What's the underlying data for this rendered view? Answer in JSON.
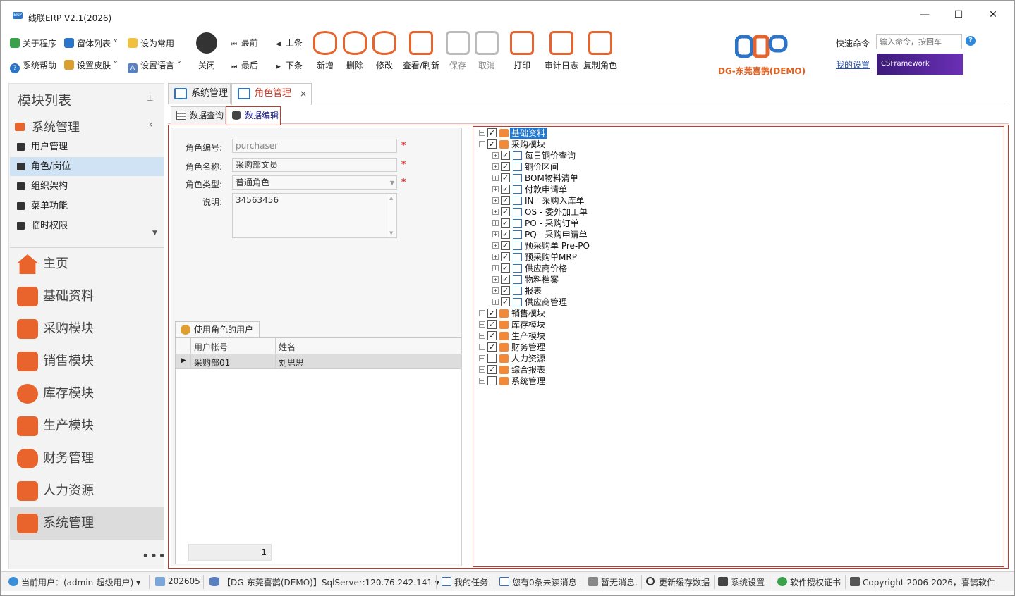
{
  "app": {
    "title": "线联ERP V2.1(2026)",
    "logo_text": "ERP"
  },
  "window_controls": {
    "minimize": "—",
    "maximize": "☐",
    "close": "✕"
  },
  "quick_menu": {
    "about": "关于程序",
    "windows": "窗体列表",
    "set_common": "设为常用",
    "help": "系统帮助",
    "skin": "设置皮肤",
    "language": "设置语言"
  },
  "toolbar": {
    "close": "关闭",
    "first": "最前",
    "prev": "上条",
    "last": "最后",
    "next": "下条",
    "add": "新增",
    "delete": "删除",
    "edit": "修改",
    "view_refresh": "查看/刷新",
    "save": "保存",
    "cancel": "取消",
    "print": "打印",
    "audit_log": "审计日志",
    "copy_role": "复制角色"
  },
  "brand": {
    "company": "DG-东莞喜鹊(DEMO)",
    "banner": "CSFramework"
  },
  "command": {
    "label": "快速命令",
    "placeholder": "输入命令，按回车",
    "my_settings": "我的设置"
  },
  "sidebar": {
    "header": "模块列表",
    "pin": "📌",
    "section": "系统管理",
    "items": [
      {
        "label": "用户管理"
      },
      {
        "label": "角色/岗位"
      },
      {
        "label": "组织架构"
      },
      {
        "label": "菜单功能"
      },
      {
        "label": "临时权限"
      }
    ],
    "modules": [
      {
        "label": "主页"
      },
      {
        "label": "基础资料"
      },
      {
        "label": "采购模块"
      },
      {
        "label": "销售模块"
      },
      {
        "label": "库存模块"
      },
      {
        "label": "生产模块"
      },
      {
        "label": "财务管理"
      },
      {
        "label": "人力资源"
      },
      {
        "label": "系统管理"
      }
    ],
    "more": "•••"
  },
  "tabs": [
    {
      "label": "系统管理"
    },
    {
      "label": "角色管理"
    }
  ],
  "subtabs": [
    {
      "label": "数据查询"
    },
    {
      "label": "数据编辑"
    }
  ],
  "form": {
    "role_code_label": "角色编号:",
    "role_code": "purchaser",
    "role_name_label": "角色名称:",
    "role_name": "采购部文员",
    "role_type_label": "角色类型:",
    "role_type": "普通角色",
    "desc_label": "说明:",
    "desc": "34563456",
    "required_mark": "*"
  },
  "users_panel": {
    "tab": "使用角色的用户",
    "columns": [
      "用户帐号",
      "姓名"
    ],
    "rows": [
      {
        "account": "采购部01",
        "name": "刘思思"
      }
    ],
    "page": "1"
  },
  "tree": [
    {
      "label": "基础资料",
      "level": 0,
      "checked": true,
      "expanded": false,
      "selected": true
    },
    {
      "label": "采购模块",
      "level": 0,
      "checked": true,
      "expanded": true
    },
    {
      "label": "每日铜价查询",
      "level": 1,
      "checked": true
    },
    {
      "label": "铜价区间",
      "level": 1,
      "checked": true
    },
    {
      "label": "BOM物料清单",
      "level": 1,
      "checked": true
    },
    {
      "label": "付款申请单",
      "level": 1,
      "checked": true
    },
    {
      "label": "IN - 采购入库单",
      "level": 1,
      "checked": true
    },
    {
      "label": "OS - 委外加工单",
      "level": 1,
      "checked": true
    },
    {
      "label": "PO - 采购订单",
      "level": 1,
      "checked": true
    },
    {
      "label": "PQ - 采购申请单",
      "level": 1,
      "checked": true
    },
    {
      "label": "预采购单 Pre-PO",
      "level": 1,
      "checked": true
    },
    {
      "label": "预采购单MRP",
      "level": 1,
      "checked": true
    },
    {
      "label": "供应商价格",
      "level": 1,
      "checked": true
    },
    {
      "label": "物料档案",
      "level": 1,
      "checked": true
    },
    {
      "label": "报表",
      "level": 1,
      "checked": true
    },
    {
      "label": "供应商管理",
      "level": 1,
      "checked": true
    },
    {
      "label": "销售模块",
      "level": 0,
      "checked": true
    },
    {
      "label": "库存模块",
      "level": 0,
      "checked": true
    },
    {
      "label": "生产模块",
      "level": 0,
      "checked": true
    },
    {
      "label": "财务管理",
      "level": 0,
      "checked": true
    },
    {
      "label": "人力资源",
      "level": 0,
      "checked": false
    },
    {
      "label": "综合报表",
      "level": 0,
      "checked": true
    },
    {
      "label": "系统管理",
      "level": 0,
      "checked": false
    }
  ],
  "status": {
    "user": "当前用户：(admin-超级用户)",
    "period": "202605",
    "db": "【DG-东莞喜鹊(DEMO)】SqlServer:120.76.242.141",
    "tasks": "我的任务",
    "messages": "您有0条未读消息",
    "notice": "暂无消息.",
    "refresh_cache": "更新缓存数据",
    "settings": "系统设置",
    "license": "软件授权证书",
    "copyright": "Copyright 2006-2026，喜鹊软件"
  },
  "colors": {
    "accent": "#e8642c",
    "tab_active": "#c0392b",
    "selection": "#1e78d6"
  }
}
